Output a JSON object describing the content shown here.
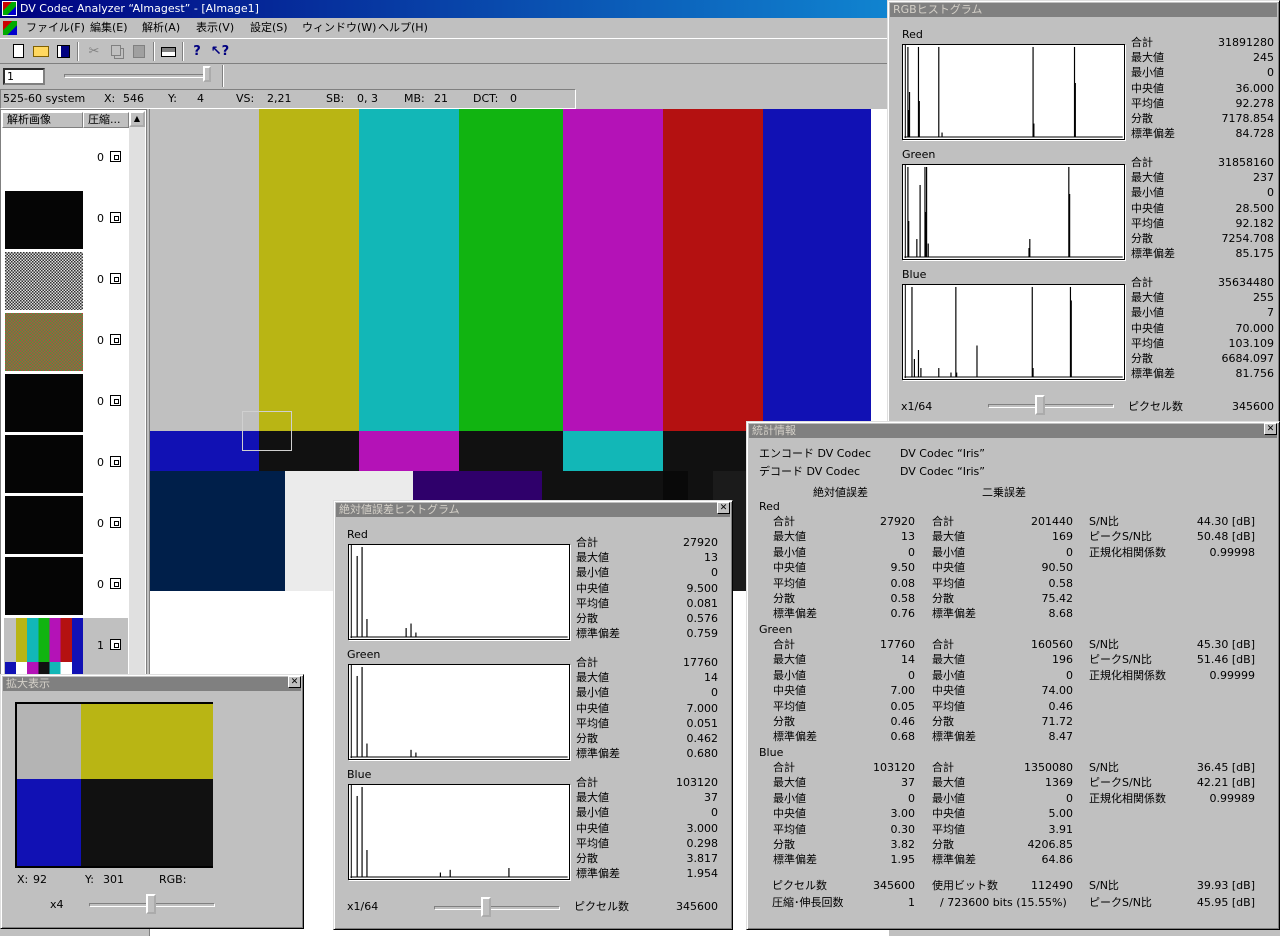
{
  "app": {
    "title": "DV Codec Analyzer “AImagest” - [AImage1]"
  },
  "menu": {
    "items": [
      "ファイル(F)",
      "編集(E)",
      "解析(A)",
      "表示(V)",
      "設定(S)",
      "ウィンドウ(W)",
      "ヘルプ(H)"
    ]
  },
  "toolbar": {
    "icons": [
      "new-file-icon",
      "open-folder-icon",
      "save-icon",
      "cut-icon",
      "copy-icon",
      "paste-icon",
      "print-icon",
      "help-icon",
      "context-help-icon"
    ]
  },
  "frame": {
    "value": "1"
  },
  "status": {
    "system": "525-60 system",
    "x_label": "X:",
    "x_value": "546",
    "y_label": "Y:",
    "y_value": "4",
    "vs_label": "VS:",
    "vs_value": "2,21",
    "sb_label": "SB:",
    "sb_value": "0, 3",
    "mb_label": "MB:",
    "mb_value": "21",
    "dct_label": "DCT:",
    "dct_value": "0"
  },
  "image_list": {
    "col1": "解析画像",
    "col2": "圧縮...",
    "rows": [
      {
        "value": "0",
        "kind": "white"
      },
      {
        "value": "0",
        "kind": "black"
      },
      {
        "value": "0",
        "kind": "gray-noise"
      },
      {
        "value": "0",
        "kind": "color-noise"
      },
      {
        "value": "0",
        "kind": "black"
      },
      {
        "value": "0",
        "kind": "black"
      },
      {
        "value": "0",
        "kind": "black"
      },
      {
        "value": "0",
        "kind": "black"
      },
      {
        "value": "1",
        "kind": "colorbars"
      }
    ]
  },
  "colorbars": {
    "top": [
      "#c0c0c0",
      "#b9b514",
      "#12b7b7",
      "#11b411",
      "#b412b7",
      "#b41111",
      "#1111b4"
    ],
    "middle": [
      "#1111b4",
      "#111111",
      "#b412b7",
      "#111111",
      "#12b7b7",
      "#111111",
      "#c0c0c0"
    ],
    "bottom": [
      "#001f4a",
      "#ebebeb",
      "#2f006b",
      "#111111",
      "#090909",
      "#111111",
      "#1b1b1b"
    ]
  },
  "zoom": {
    "title": "拡大表示",
    "x_label": "X:",
    "x_value": "92",
    "y_label": "Y:",
    "y_value": "301",
    "rgb_label": "RGB:",
    "scale": "x4",
    "cells": [
      "#b4b4b4",
      "#b9b514",
      "#1111b4",
      "#111111"
    ]
  },
  "rgb_hist": {
    "title": "RGBヒストグラム",
    "scale": "x1/64",
    "pixel_label": "ピクセル数",
    "pixel_value": "345600",
    "channels": [
      {
        "name": "Red",
        "stats": [
          [
            "合計",
            "31891280"
          ],
          [
            "最大値",
            "245"
          ],
          [
            "最小値",
            "0"
          ],
          [
            "中央値",
            "36.000"
          ],
          [
            "平均値",
            "92.278"
          ],
          [
            "分散",
            "7178.854"
          ],
          [
            "標準偏差",
            "84.728"
          ]
        ],
        "lines": [
          [
            2,
            1.0
          ],
          [
            3,
            0.3
          ],
          [
            4,
            0.5
          ],
          [
            15,
            1.0
          ],
          [
            16,
            0.4
          ],
          [
            40,
            1.0
          ],
          [
            44,
            0.05
          ],
          [
            156,
            1.0
          ],
          [
            157,
            0.15
          ],
          [
            207,
            1.0
          ],
          [
            208,
            0.6
          ]
        ]
      },
      {
        "name": "Green",
        "stats": [
          [
            "合計",
            "31858160"
          ],
          [
            "最大値",
            "237"
          ],
          [
            "最小値",
            "0"
          ],
          [
            "中央値",
            "28.500"
          ],
          [
            "平均値",
            "92.182"
          ],
          [
            "分散",
            "7254.708"
          ],
          [
            "標準偏差",
            "85.175"
          ]
        ],
        "lines": [
          [
            2,
            1.0
          ],
          [
            3,
            0.4
          ],
          [
            13,
            0.2
          ],
          [
            17,
            0.8
          ],
          [
            23,
            1.0
          ],
          [
            24,
            0.5
          ],
          [
            25,
            1.0
          ],
          [
            27,
            0.15
          ],
          [
            151,
            0.1
          ],
          [
            152,
            0.2
          ],
          [
            200,
            1.0
          ],
          [
            201,
            0.7
          ]
        ]
      },
      {
        "name": "Blue",
        "stats": [
          [
            "合計",
            "35634480"
          ],
          [
            "最大値",
            "255"
          ],
          [
            "最小値",
            "7"
          ],
          [
            "中央値",
            "70.000"
          ],
          [
            "平均値",
            "103.109"
          ],
          [
            "分散",
            "6684.097"
          ],
          [
            "標準偏差",
            "81.756"
          ]
        ],
        "lines": [
          [
            7,
            1.0
          ],
          [
            10,
            0.2
          ],
          [
            15,
            0.3
          ],
          [
            18,
            0.1
          ],
          [
            40,
            0.1
          ],
          [
            55,
            0.05
          ],
          [
            61,
            1.0
          ],
          [
            62,
            0.05
          ],
          [
            87,
            0.35
          ],
          [
            155,
            1.0
          ],
          [
            156,
            0.1
          ],
          [
            202,
            1.0
          ],
          [
            203,
            0.85
          ]
        ]
      }
    ]
  },
  "abs_hist": {
    "title": "絶対値誤差ヒストグラム",
    "scale": "x1/64",
    "pixel_label": "ピクセル数",
    "pixel_value": "345600",
    "channels": [
      {
        "name": "Red",
        "stats": [
          [
            "合計",
            "27920"
          ],
          [
            "最大値",
            "13"
          ],
          [
            "最小値",
            "0"
          ],
          [
            "中央値",
            "9.500"
          ],
          [
            "平均値",
            "0.081"
          ],
          [
            "分散",
            "0.576"
          ],
          [
            "標準偏差",
            "0.759"
          ]
        ],
        "lines": [
          [
            1,
            0.9
          ],
          [
            2,
            1.0
          ],
          [
            3,
            0.2
          ],
          [
            11,
            0.1
          ],
          [
            12,
            0.15
          ],
          [
            13,
            0.05
          ]
        ]
      },
      {
        "name": "Green",
        "stats": [
          [
            "合計",
            "17760"
          ],
          [
            "最大値",
            "14"
          ],
          [
            "最小値",
            "0"
          ],
          [
            "中央値",
            "7.000"
          ],
          [
            "平均値",
            "0.051"
          ],
          [
            "分散",
            "0.462"
          ],
          [
            "標準偏差",
            "0.680"
          ]
        ],
        "lines": [
          [
            1,
            0.9
          ],
          [
            2,
            1.0
          ],
          [
            3,
            0.15
          ],
          [
            12,
            0.08
          ],
          [
            13,
            0.05
          ]
        ]
      },
      {
        "name": "Blue",
        "stats": [
          [
            "合計",
            "103120"
          ],
          [
            "最大値",
            "37"
          ],
          [
            "最小値",
            "0"
          ],
          [
            "中央値",
            "3.000"
          ],
          [
            "平均値",
            "0.298"
          ],
          [
            "分散",
            "3.817"
          ],
          [
            "標準偏差",
            "1.954"
          ]
        ],
        "lines": [
          [
            1,
            0.9
          ],
          [
            2,
            1.0
          ],
          [
            3,
            0.3
          ],
          [
            18,
            0.05
          ],
          [
            20,
            0.08
          ],
          [
            32,
            0.1
          ]
        ]
      }
    ]
  },
  "stats_info": {
    "title": "統計情報",
    "encode_label": "エンコード DV Codec",
    "encode_value": "DV Codec “Iris”",
    "decode_label": "デコード DV Codec",
    "decode_value": "DV Codec “Iris”",
    "abs_header": "絶対値誤差",
    "sq_header": "二乗誤差",
    "channels": [
      {
        "name": "Red",
        "abs": [
          [
            "合計",
            "27920"
          ],
          [
            "最大値",
            "13"
          ],
          [
            "最小値",
            "0"
          ],
          [
            "中央値",
            "9.50"
          ],
          [
            "平均値",
            "0.08"
          ],
          [
            "分散",
            "0.58"
          ],
          [
            "標準偏差",
            "0.76"
          ]
        ],
        "sq": [
          [
            "合計",
            "201440"
          ],
          [
            "最大値",
            "169"
          ],
          [
            "最小値",
            "0"
          ],
          [
            "中央値",
            "90.50"
          ],
          [
            "平均値",
            "0.58"
          ],
          [
            "分散",
            "75.42"
          ],
          [
            "標準偏差",
            "8.68"
          ]
        ],
        "snr": [
          [
            "S/N比",
            "44.30 [dB]"
          ],
          [
            "ピークS/N比",
            "50.48 [dB]"
          ],
          [
            "正規化相関係数",
            "0.99998"
          ]
        ]
      },
      {
        "name": "Green",
        "abs": [
          [
            "合計",
            "17760"
          ],
          [
            "最大値",
            "14"
          ],
          [
            "最小値",
            "0"
          ],
          [
            "中央値",
            "7.00"
          ],
          [
            "平均値",
            "0.05"
          ],
          [
            "分散",
            "0.46"
          ],
          [
            "標準偏差",
            "0.68"
          ]
        ],
        "sq": [
          [
            "合計",
            "160560"
          ],
          [
            "最大値",
            "196"
          ],
          [
            "最小値",
            "0"
          ],
          [
            "中央値",
            "74.00"
          ],
          [
            "平均値",
            "0.46"
          ],
          [
            "分散",
            "71.72"
          ],
          [
            "標準偏差",
            "8.47"
          ]
        ],
        "snr": [
          [
            "S/N比",
            "45.30 [dB]"
          ],
          [
            "ピークS/N比",
            "51.46 [dB]"
          ],
          [
            "正規化相関係数",
            "0.99999"
          ]
        ]
      },
      {
        "name": "Blue",
        "abs": [
          [
            "合計",
            "103120"
          ],
          [
            "最大値",
            "37"
          ],
          [
            "最小値",
            "0"
          ],
          [
            "中央値",
            "3.00"
          ],
          [
            "平均値",
            "0.30"
          ],
          [
            "分散",
            "3.82"
          ],
          [
            "標準偏差",
            "1.95"
          ]
        ],
        "sq": [
          [
            "合計",
            "1350080"
          ],
          [
            "最大値",
            "1369"
          ],
          [
            "最小値",
            "0"
          ],
          [
            "中央値",
            "5.00"
          ],
          [
            "平均値",
            "3.91"
          ],
          [
            "分散",
            "4206.85"
          ],
          [
            "標準偏差",
            "64.86"
          ]
        ],
        "snr": [
          [
            "S/N比",
            "36.45 [dB]"
          ],
          [
            "ピークS/N比",
            "42.21 [dB]"
          ],
          [
            "正規化相関係数",
            "0.99989"
          ]
        ]
      }
    ],
    "footer": {
      "pixel_label": "ピクセル数",
      "pixel_value": "345600",
      "bits_label": "使用ビット数",
      "bits_value": "112490",
      "comp_label": "圧縮･伸長回数",
      "comp_value": "1",
      "bits_detail": "/ 723600 bits (15.55%)",
      "snr_label": "S/N比",
      "snr_value": "39.93 [dB]",
      "psnr_label": "ピークS/N比",
      "psnr_value": "45.95 [dB]"
    }
  }
}
